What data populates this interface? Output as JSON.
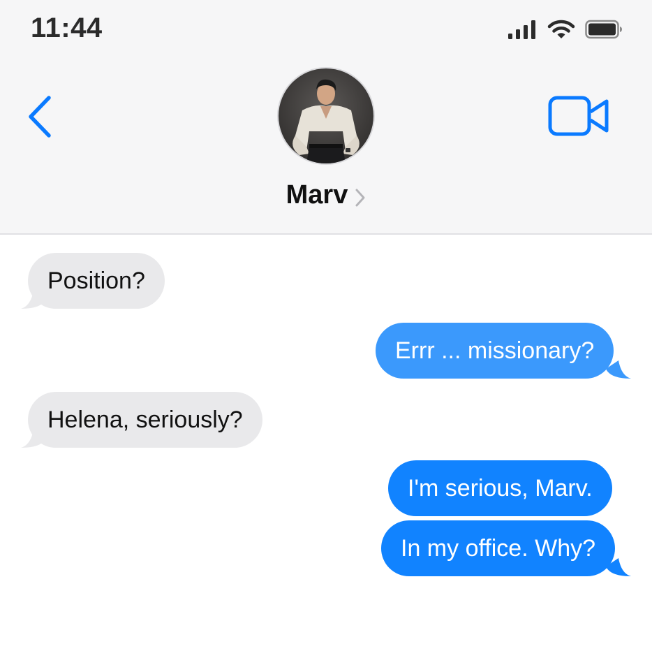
{
  "status_bar": {
    "time": "11:44",
    "icons": [
      "signal-icon",
      "wifi-icon",
      "battery-icon"
    ]
  },
  "nav": {
    "back_icon": "chevron-left-icon",
    "video_icon": "video-camera-icon",
    "contact_name": "Marv",
    "contact_chevron_icon": "chevron-right-icon"
  },
  "colors": {
    "accent": "#0a7aff",
    "incoming_bubble": "#e9e9eb",
    "outgoing_bubble_light": "#3b99fc",
    "outgoing_bubble": "#1183ff",
    "header_bg": "#f6f6f7"
  },
  "messages": [
    {
      "direction": "incoming",
      "text": "Position?"
    },
    {
      "direction": "outgoing",
      "text": "Errr ... missionary?"
    },
    {
      "direction": "incoming",
      "text": "Helena, seriously?"
    },
    {
      "direction": "outgoing",
      "text": "I'm serious, Marv."
    },
    {
      "direction": "outgoing",
      "text": "In my office. Why?"
    }
  ]
}
